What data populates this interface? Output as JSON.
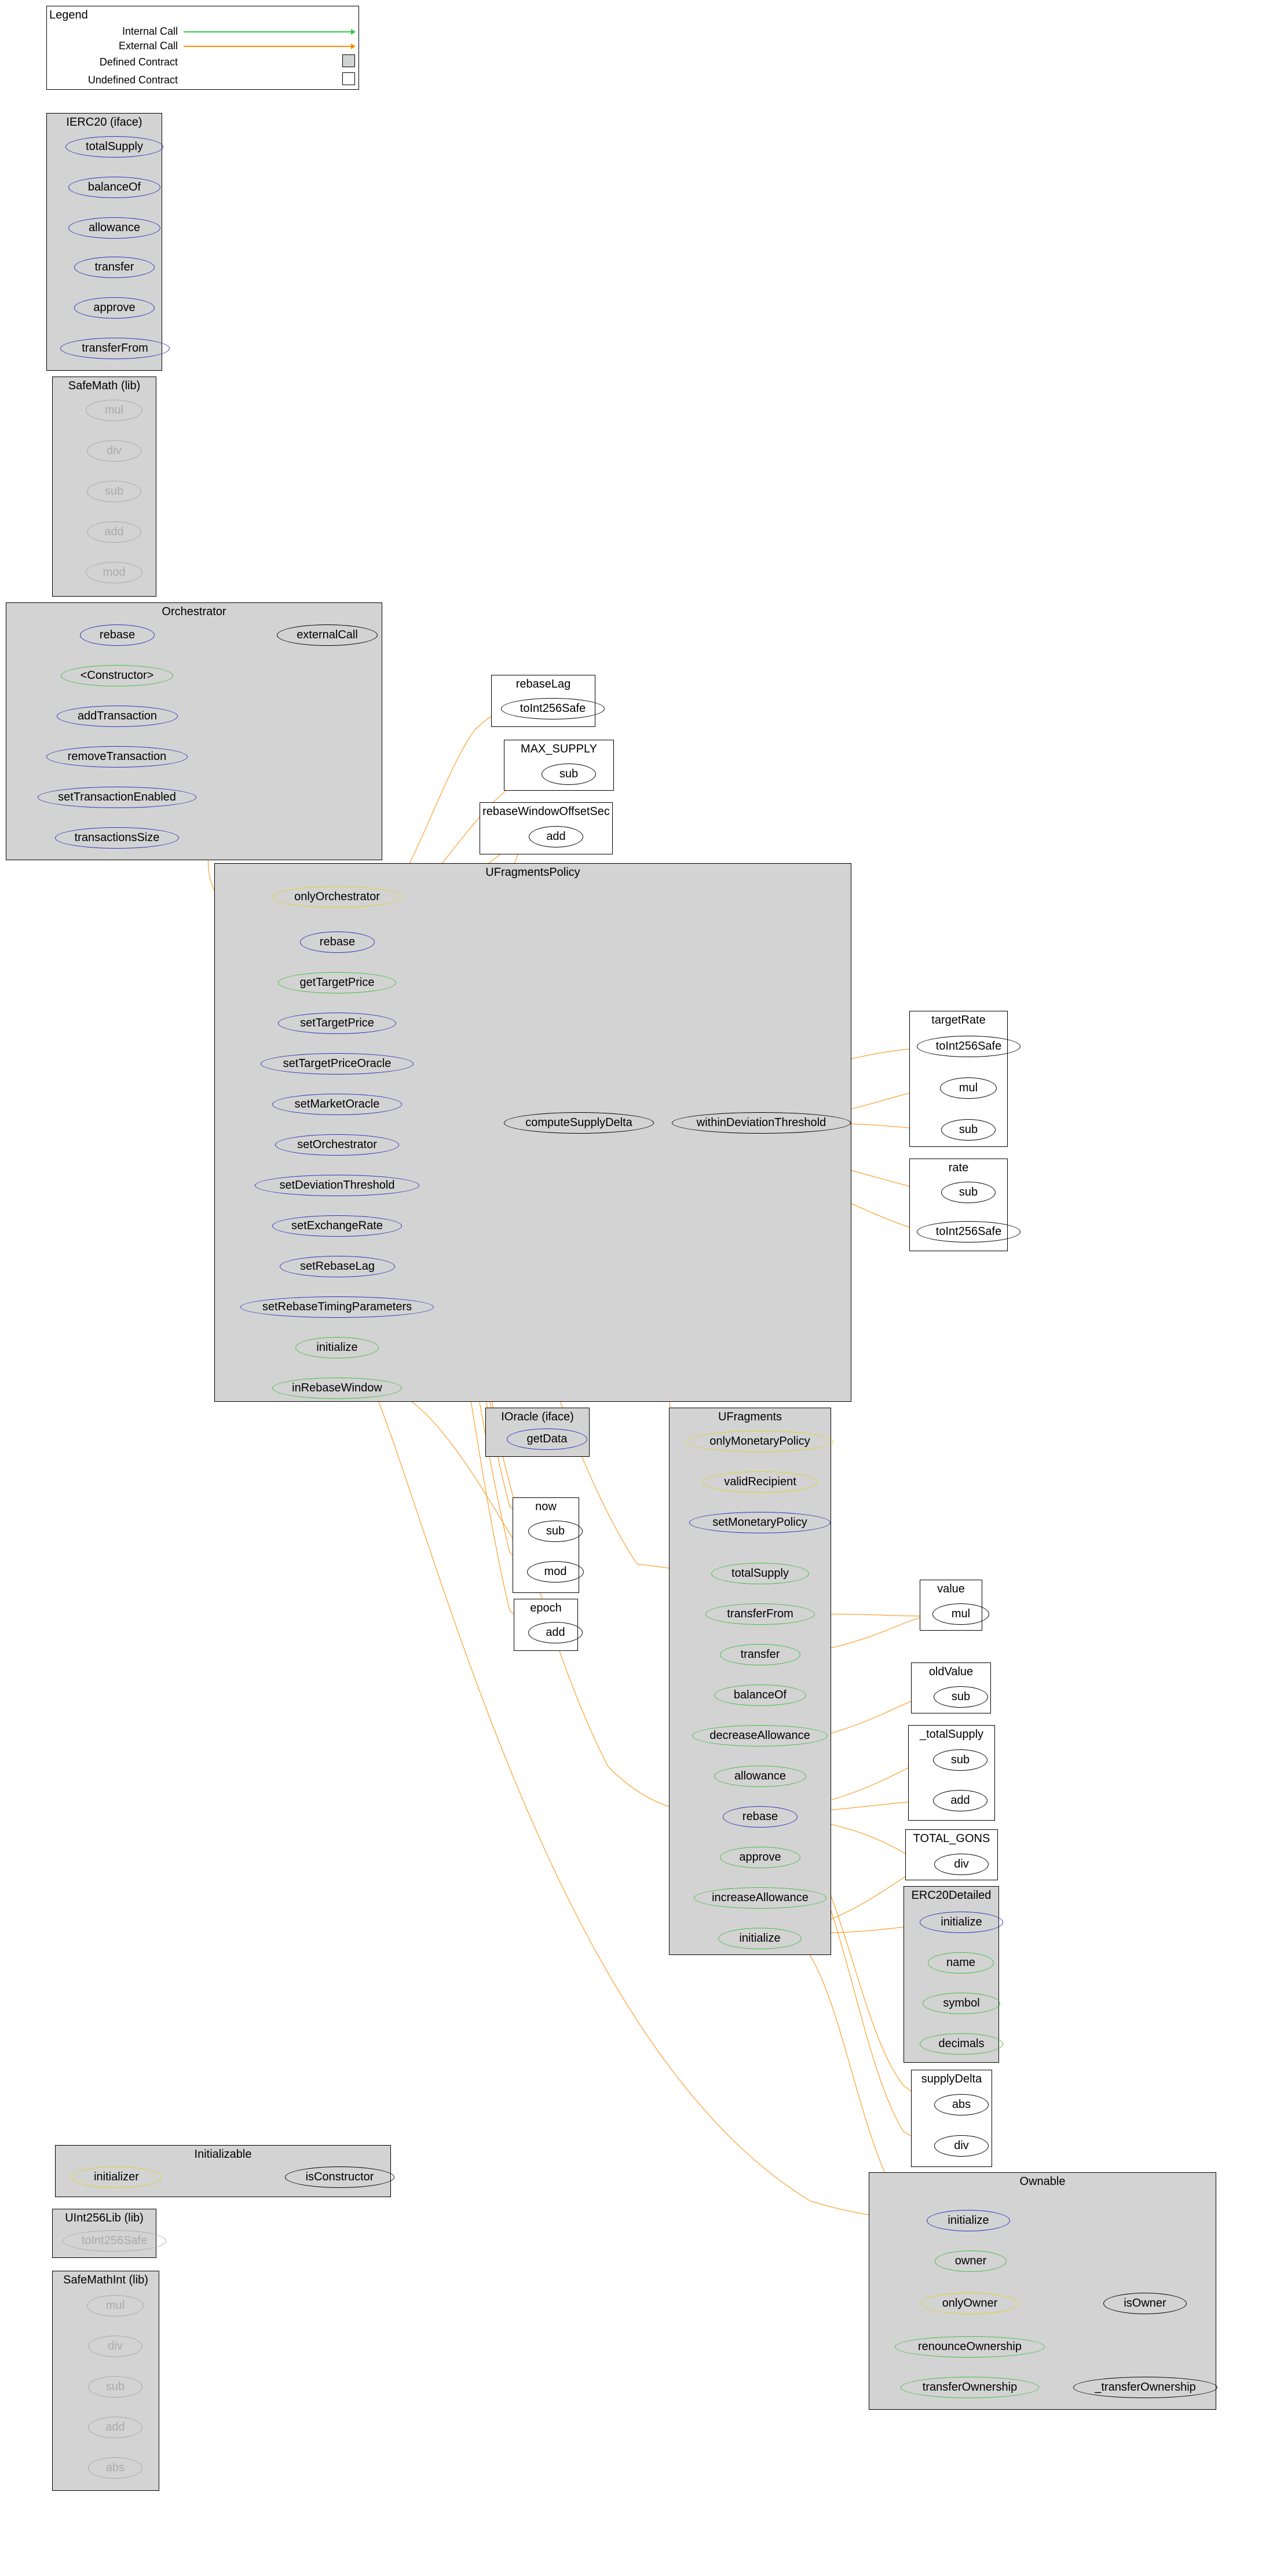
{
  "legend": {
    "title": "Legend",
    "internal_call": "Internal Call",
    "external_call": "External Call",
    "defined_contract": "Defined Contract",
    "undefined_contract": "Undefined Contract"
  },
  "contracts": {
    "IERC20": {
      "title": "IERC20  (iface)",
      "nodes": {
        "totalSupply": "totalSupply",
        "balanceOf": "balanceOf",
        "allowance": "allowance",
        "transfer": "transfer",
        "approve": "approve",
        "transferFrom": "transferFrom"
      }
    },
    "SafeMath": {
      "title": "SafeMath  (lib)",
      "nodes": {
        "mul": "mul",
        "div": "div",
        "sub": "sub",
        "add": "add",
        "mod": "mod"
      }
    },
    "Orchestrator": {
      "title": "Orchestrator",
      "nodes": {
        "rebase": "rebase",
        "externalCall": "externalCall",
        "constructor": "<Constructor>",
        "addTransaction": "addTransaction",
        "removeTransaction": "removeTransaction",
        "setTransactionEnabled": "setTransactionEnabled",
        "transactionsSize": "transactionsSize"
      }
    },
    "rebaseLag": {
      "title": "rebaseLag",
      "nodes": {
        "toInt256Safe": "toInt256Safe"
      }
    },
    "MAX_SUPPLY": {
      "title": "MAX_SUPPLY",
      "nodes": {
        "sub": "sub"
      }
    },
    "rebaseWindowOffsetSec": {
      "title": "rebaseWindowOffsetSec",
      "nodes": {
        "add": "add"
      }
    },
    "UFragmentsPolicy": {
      "title": "UFragmentsPolicy",
      "nodes": {
        "onlyOrchestrator": "onlyOrchestrator",
        "rebase": "rebase",
        "getTargetPrice": "getTargetPrice",
        "setTargetPrice": "setTargetPrice",
        "setTargetPriceOracle": "setTargetPriceOracle",
        "setMarketOracle": "setMarketOracle",
        "setOrchestrator": "setOrchestrator",
        "setDeviationThreshold": "setDeviationThreshold",
        "setExchangeRate": "setExchangeRate",
        "setRebaseLag": "setRebaseLag",
        "setRebaseTimingParameters": "setRebaseTimingParameters",
        "initialize": "initialize",
        "inRebaseWindow": "inRebaseWindow",
        "computeSupplyDelta": "computeSupplyDelta",
        "withinDeviationThreshold": "withinDeviationThreshold"
      }
    },
    "targetRate": {
      "title": "targetRate",
      "nodes": {
        "toInt256Safe": "toInt256Safe",
        "mul": "mul",
        "sub": "sub"
      }
    },
    "rate": {
      "title": "rate",
      "nodes": {
        "sub": "sub",
        "toInt256Safe": "toInt256Safe"
      }
    },
    "IOracle": {
      "title": "IOracle  (iface)",
      "nodes": {
        "getData": "getData"
      }
    },
    "UFragments": {
      "title": "UFragments",
      "nodes": {
        "onlyMonetaryPolicy": "onlyMonetaryPolicy",
        "validRecipient": "validRecipient",
        "setMonetaryPolicy": "setMonetaryPolicy",
        "totalSupply": "totalSupply",
        "transferFrom": "transferFrom",
        "transfer": "transfer",
        "balanceOf": "balanceOf",
        "decreaseAllowance": "decreaseAllowance",
        "allowance": "allowance",
        "rebase": "rebase",
        "approve": "approve",
        "increaseAllowance": "increaseAllowance",
        "initialize": "initialize"
      }
    },
    "now": {
      "title": "now",
      "nodes": {
        "sub": "sub",
        "mod": "mod"
      }
    },
    "epoch": {
      "title": "epoch",
      "nodes": {
        "add": "add"
      }
    },
    "value": {
      "title": "value",
      "nodes": {
        "mul": "mul"
      }
    },
    "oldValue": {
      "title": "oldValue",
      "nodes": {
        "sub": "sub"
      }
    },
    "_totalSupply": {
      "title": "_totalSupply",
      "nodes": {
        "sub": "sub",
        "add": "add"
      }
    },
    "TOTAL_GONS": {
      "title": "TOTAL_GONS",
      "nodes": {
        "div": "div"
      }
    },
    "ERC20Detailed": {
      "title": "ERC20Detailed",
      "nodes": {
        "initialize": "initialize",
        "name": "name",
        "symbol": "symbol",
        "decimals": "decimals"
      }
    },
    "supplyDelta": {
      "title": "supplyDelta",
      "nodes": {
        "abs": "abs",
        "div": "div"
      }
    },
    "Initializable": {
      "title": "Initializable",
      "nodes": {
        "initializer": "initializer",
        "isConstructor": "isConstructor"
      }
    },
    "UInt256Lib": {
      "title": "UInt256Lib  (lib)",
      "nodes": {
        "toInt256Safe": "toInt256Safe"
      }
    },
    "SafeMathInt": {
      "title": "SafeMathInt  (lib)",
      "nodes": {
        "mul": "mul",
        "div": "div",
        "sub": "sub",
        "add": "add",
        "abs": "abs"
      }
    },
    "Ownable": {
      "title": "Ownable",
      "nodes": {
        "initialize": "initialize",
        "owner": "owner",
        "onlyOwner": "onlyOwner",
        "isOwner": "isOwner",
        "renounceOwnership": "renounceOwnership",
        "transferOwnership": "transferOwnership",
        "_transferOwnership": "_transferOwnership"
      }
    }
  },
  "chart_data": {
    "type": "graph",
    "description": "Solidity contract call graph",
    "edge_types": {
      "internal": "green",
      "external": "orange"
    },
    "edges": [
      {
        "from": "Orchestrator.rebase",
        "to": "Orchestrator.externalCall",
        "type": "internal"
      },
      {
        "from": "Orchestrator.rebase",
        "to": "UFragmentsPolicy.rebase",
        "type": "external"
      },
      {
        "from": "UFragmentsPolicy.rebase",
        "to": "UFragmentsPolicy.computeSupplyDelta",
        "type": "internal"
      },
      {
        "from": "UFragmentsPolicy.rebase",
        "to": "UFragmentsPolicy.inRebaseWindow",
        "type": "internal"
      },
      {
        "from": "UFragmentsPolicy.rebase",
        "to": "rebaseLag.toInt256Safe",
        "type": "external"
      },
      {
        "from": "UFragmentsPolicy.rebase",
        "to": "MAX_SUPPLY.sub",
        "type": "external"
      },
      {
        "from": "UFragmentsPolicy.rebase",
        "to": "rebaseWindowOffsetSec.add",
        "type": "external"
      },
      {
        "from": "UFragmentsPolicy.rebase",
        "to": "IOracle.getData",
        "type": "external"
      },
      {
        "from": "UFragmentsPolicy.rebase",
        "to": "UFragments.totalSupply",
        "type": "external"
      },
      {
        "from": "UFragmentsPolicy.rebase",
        "to": "UFragments.rebase",
        "type": "external"
      },
      {
        "from": "UFragmentsPolicy.rebase",
        "to": "now.sub",
        "type": "external"
      },
      {
        "from": "UFragmentsPolicy.rebase",
        "to": "now.mod",
        "type": "external"
      },
      {
        "from": "UFragmentsPolicy.rebase",
        "to": "epoch.add",
        "type": "external"
      },
      {
        "from": "UFragmentsPolicy.computeSupplyDelta",
        "to": "UFragmentsPolicy.withinDeviationThreshold",
        "type": "internal"
      },
      {
        "from": "UFragmentsPolicy.computeSupplyDelta",
        "to": "UFragments.totalSupply",
        "type": "external"
      },
      {
        "from": "UFragmentsPolicy.computeSupplyDelta",
        "to": "targetRate.toInt256Safe",
        "type": "external"
      },
      {
        "from": "UFragmentsPolicy.computeSupplyDelta",
        "to": "rate.sub",
        "type": "external"
      },
      {
        "from": "UFragmentsPolicy.computeSupplyDelta",
        "to": "rate.toInt256Safe",
        "type": "external"
      },
      {
        "from": "UFragmentsPolicy.withinDeviationThreshold",
        "to": "targetRate.mul",
        "type": "external"
      },
      {
        "from": "UFragmentsPolicy.withinDeviationThreshold",
        "to": "targetRate.sub",
        "type": "external"
      },
      {
        "from": "UFragmentsPolicy.inRebaseWindow",
        "to": "now.mod",
        "type": "external"
      },
      {
        "from": "UFragmentsPolicy.inRebaseWindow",
        "to": "rebaseWindowOffsetSec.add",
        "type": "external"
      },
      {
        "from": "UFragmentsPolicy.initialize",
        "to": "Ownable.initialize",
        "type": "external"
      },
      {
        "from": "UFragments.transferFrom",
        "to": "value.mul",
        "type": "external"
      },
      {
        "from": "UFragments.transfer",
        "to": "value.mul",
        "type": "external"
      },
      {
        "from": "UFragments.decreaseAllowance",
        "to": "oldValue.sub",
        "type": "external"
      },
      {
        "from": "UFragments.rebase",
        "to": "_totalSupply.sub",
        "type": "external"
      },
      {
        "from": "UFragments.rebase",
        "to": "_totalSupply.add",
        "type": "external"
      },
      {
        "from": "UFragments.rebase",
        "to": "TOTAL_GONS.div",
        "type": "external"
      },
      {
        "from": "UFragments.rebase",
        "to": "supplyDelta.abs",
        "type": "external"
      },
      {
        "from": "UFragments.rebase",
        "to": "supplyDelta.div",
        "type": "external"
      },
      {
        "from": "UFragments.initialize",
        "to": "ERC20Detailed.initialize",
        "type": "external"
      },
      {
        "from": "UFragments.initialize",
        "to": "Ownable.initialize",
        "type": "external"
      },
      {
        "from": "UFragments.initialize",
        "to": "TOTAL_GONS.div",
        "type": "external"
      },
      {
        "from": "Initializable.initializer",
        "to": "Initializable.isConstructor",
        "type": "internal"
      },
      {
        "from": "Ownable.onlyOwner",
        "to": "Ownable.isOwner",
        "type": "internal"
      },
      {
        "from": "Ownable.transferOwnership",
        "to": "Ownable._transferOwnership",
        "type": "internal"
      }
    ]
  }
}
